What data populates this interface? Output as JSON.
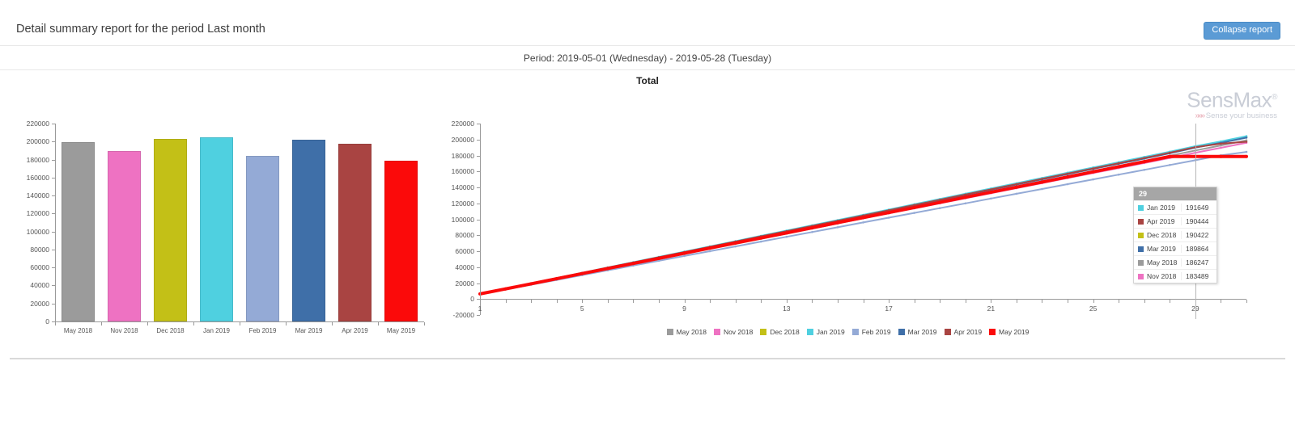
{
  "header": {
    "title": "Detail summary report for the period Last month",
    "collapse_label": "Collapse report"
  },
  "period": {
    "text": "Period: 2019-05-01 (Wednesday) - 2019-05-28 (Tuesday)"
  },
  "section": {
    "total_label": "Total"
  },
  "logo": {
    "name": "SensMax",
    "registered": "®",
    "chevrons": "»»»",
    "tagline": "Sense your business"
  },
  "tooltip": {
    "header": "29",
    "rows": [
      {
        "label": "Jan 2019",
        "value": "191649",
        "color": "#4FD0E0"
      },
      {
        "label": "Apr 2019",
        "value": "190444",
        "color": "#A94442"
      },
      {
        "label": "Dec 2018",
        "value": "190422",
        "color": "#C3C017"
      },
      {
        "label": "Mar 2019",
        "value": "189864",
        "color": "#3F6FA8"
      },
      {
        "label": "May 2018",
        "value": "186247",
        "color": "#9B9B9B"
      },
      {
        "label": "Nov 2018",
        "value": "183489",
        "color": "#EE72C2"
      }
    ]
  },
  "legend": {
    "items": [
      {
        "label": "May 2018",
        "color": "#9B9B9B"
      },
      {
        "label": "Nov 2018",
        "color": "#EE72C2"
      },
      {
        "label": "Dec 2018",
        "color": "#C3C017"
      },
      {
        "label": "Jan 2019",
        "color": "#4FD0E0"
      },
      {
        "label": "Feb 2019",
        "color": "#94AAD6"
      },
      {
        "label": "Mar 2019",
        "color": "#3F6FA8"
      },
      {
        "label": "Apr 2019",
        "color": "#A94442"
      },
      {
        "label": "May 2019",
        "color": "#FB0A0A"
      }
    ]
  },
  "chart_data": [
    {
      "type": "bar",
      "title": "Total",
      "xlabel": "",
      "ylabel": "",
      "ylim": [
        0,
        220000
      ],
      "ytick_step": 20000,
      "yticks": [
        0,
        20000,
        40000,
        60000,
        80000,
        100000,
        120000,
        140000,
        160000,
        180000,
        200000,
        220000
      ],
      "grid": false,
      "categories": [
        "May 2018",
        "Nov 2018",
        "Dec 2018",
        "Jan 2019",
        "Feb 2019",
        "Mar 2019",
        "Apr 2019",
        "May 2019"
      ],
      "values": [
        199500,
        189600,
        203400,
        204300,
        184500,
        202400,
        197200,
        178700
      ],
      "colors": [
        "#9B9B9B",
        "#EE72C2",
        "#C3C017",
        "#4FD0E0",
        "#94AAD6",
        "#3F6FA8",
        "#A94442",
        "#FB0A0A"
      ]
    },
    {
      "type": "line",
      "title": "Total",
      "xlabel": "",
      "ylabel": "",
      "ylim": [
        -20000,
        220000
      ],
      "ytick_step": 20000,
      "yticks": [
        -20000,
        0,
        20000,
        40000,
        60000,
        80000,
        100000,
        120000,
        140000,
        160000,
        180000,
        200000,
        220000
      ],
      "xlim": [
        1,
        31
      ],
      "xticks": [
        1,
        5,
        9,
        13,
        17,
        21,
        25,
        29
      ],
      "grid": false,
      "legend_position": "bottom",
      "annotation": {
        "x": 29,
        "label": "29"
      },
      "x": [
        1,
        2,
        3,
        4,
        5,
        6,
        7,
        8,
        9,
        10,
        11,
        12,
        13,
        14,
        15,
        16,
        17,
        18,
        19,
        20,
        21,
        22,
        23,
        24,
        25,
        26,
        27,
        28,
        29,
        30,
        31
      ],
      "series": [
        {
          "name": "May 2018",
          "color": "#9B9B9B",
          "values": [
            6400,
            12800,
            19200,
            25700,
            32100,
            38500,
            44900,
            51300,
            57700,
            64200,
            70600,
            77000,
            83400,
            89800,
            96200,
            102700,
            109100,
            115500,
            121900,
            128300,
            134700,
            141200,
            147600,
            154000,
            160400,
            166800,
            173200,
            179700,
            186247,
            192600,
            199000
          ]
        },
        {
          "name": "Nov 2018",
          "color": "#EE72C2",
          "values": [
            6300,
            12600,
            18900,
            25300,
            31600,
            37900,
            44200,
            50500,
            56800,
            63200,
            69500,
            75800,
            82100,
            88400,
            94700,
            101100,
            107400,
            113700,
            120000,
            126300,
            132600,
            139000,
            145300,
            151600,
            157900,
            164200,
            170500,
            176900,
            183489,
            189600,
            195900
          ]
        },
        {
          "name": "Dec 2018",
          "color": "#C3C017",
          "values": [
            6500,
            13100,
            19600,
            26200,
            32700,
            39300,
            45800,
            52400,
            58900,
            65500,
            72000,
            78600,
            85100,
            91700,
            98200,
            104800,
            111300,
            117900,
            124400,
            131000,
            137500,
            144100,
            150600,
            157200,
            163700,
            170300,
            176800,
            183400,
            190422,
            196500,
            203000
          ]
        },
        {
          "name": "Jan 2019",
          "color": "#4FD0E0",
          "values": [
            6600,
            13200,
            19800,
            26400,
            33000,
            39600,
            46200,
            52800,
            59400,
            66000,
            72600,
            79200,
            85800,
            92400,
            99000,
            105600,
            112200,
            118800,
            125400,
            132000,
            138600,
            145200,
            151800,
            158400,
            165000,
            171600,
            178200,
            184800,
            191649,
            197600,
            204200
          ]
        },
        {
          "name": "Feb 2019",
          "color": "#94AAD6",
          "values": [
            6000,
            12000,
            18000,
            24000,
            30000,
            36000,
            42000,
            48000,
            54000,
            60000,
            66000,
            72000,
            78000,
            84000,
            90000,
            96000,
            102000,
            108000,
            114000,
            120000,
            126000,
            132000,
            138000,
            144000,
            150000,
            156000,
            162000,
            168000,
            174000,
            180200,
            184500
          ]
        },
        {
          "name": "Mar 2019",
          "color": "#3F6FA8",
          "values": [
            6500,
            13000,
            19500,
            26100,
            32600,
            39100,
            45600,
            52200,
            58700,
            65200,
            71700,
            78300,
            84800,
            91300,
            97800,
            104400,
            110900,
            117400,
            123900,
            130500,
            137000,
            143500,
            150000,
            156600,
            163100,
            169600,
            176100,
            182700,
            189864,
            195800,
            202400
          ]
        },
        {
          "name": "Apr 2019",
          "color": "#A94442",
          "values": [
            6500,
            13100,
            19600,
            26200,
            32700,
            39300,
            45800,
            52400,
            58900,
            65500,
            72000,
            78600,
            85100,
            91700,
            98200,
            104800,
            111300,
            117900,
            124400,
            131000,
            137500,
            144100,
            150600,
            157200,
            163700,
            170300,
            176800,
            183400,
            190444,
            194800,
            197200
          ]
        },
        {
          "name": "May 2019",
          "color": "#FB0A0A",
          "values": [
            6400,
            12700,
            19100,
            25500,
            31900,
            38300,
            44600,
            51000,
            57400,
            63800,
            70200,
            76500,
            82900,
            89300,
            95700,
            102100,
            108400,
            114800,
            121200,
            127600,
            134000,
            140300,
            146700,
            153100,
            159500,
            165900,
            172200,
            178700,
            178700,
            178700,
            178700
          ]
        }
      ]
    }
  ]
}
